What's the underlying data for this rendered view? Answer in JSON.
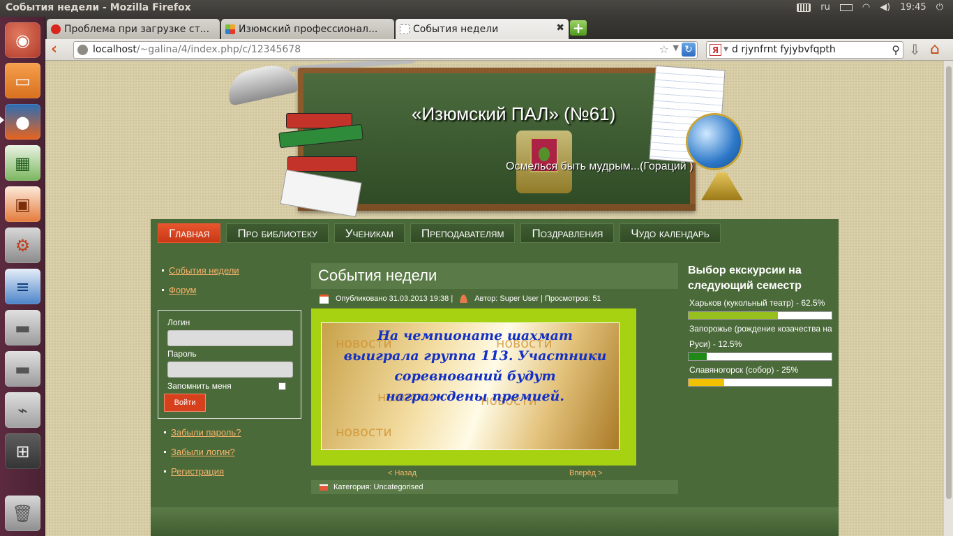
{
  "panel": {
    "window_title": "События недели - Mozilla Firefox",
    "keyboard_layout": "ru",
    "clock": "19:45",
    "icons": [
      "keyboard-icon",
      "battery-icon",
      "wifi-icon",
      "volume-icon"
    ]
  },
  "launcher": {
    "items": [
      "ubuntu-dash",
      "files",
      "firefox",
      "libreoffice-calc",
      "libreoffice-impress",
      "system-settings",
      "libreoffice-writer",
      "disk-1",
      "disk-2",
      "usb-drive",
      "workspace-switcher",
      "trash"
    ]
  },
  "tabs": [
    {
      "label": "Проблема при загрузке ст...",
      "icon": "warning-icon"
    },
    {
      "label": "Изюмский профессионал...",
      "icon": "joomla-icon"
    },
    {
      "label": "События недели",
      "icon": "blank-page-icon"
    }
  ],
  "navbar": {
    "url_host": "localhost",
    "url_path": "/~galina/4/index.php/c/12345678",
    "search_engine": "Я",
    "search_text": "d rjynfrnt fyjybvfqpth"
  },
  "site": {
    "title": "«Изюмский ПАЛ» (№61)",
    "slogan": "Осмелься быть мудрым...(Гораций )"
  },
  "menu": [
    {
      "label": "Главная",
      "active": true
    },
    {
      "label": "Про библиотеку",
      "active": false
    },
    {
      "label": "Ученикам",
      "active": false
    },
    {
      "label": "Преподавателям",
      "active": false
    },
    {
      "label": "Поздравления",
      "active": false
    },
    {
      "label": "Чудо календарь",
      "active": false
    }
  ],
  "sidebar": {
    "links": [
      "События недели",
      "Форум"
    ],
    "login": {
      "username_label": "Логин",
      "password_label": "Пароль",
      "remember_label": "Запомнить меня",
      "submit_label": "Войти"
    },
    "links2": [
      "Забыли пароль?",
      "Забыли логин?",
      "Регистрация"
    ]
  },
  "article": {
    "title": "События недели",
    "published": "Опубликовано 31.03.2013 19:38 |",
    "author": "Автор: Super User | Просмотров: 51",
    "image_text": "На чемпионате шахмат выиграла группа 113. Участники соревнований будут награждены премией.",
    "watermark": "новости",
    "prev": "< Назад",
    "next": "Вперёд >",
    "category": "Категория: Uncategorised"
  },
  "poll": {
    "title": "Выбор екскурсии на следующий семестр",
    "options": [
      {
        "label": "Харьков (кукольный театр) - 62.5%",
        "value": 62.5,
        "color": "#97c01e"
      },
      {
        "label": "Запорожье (рождение козачества на Руси) - 12.5%",
        "value": 12.5,
        "color": "#1f8a18"
      },
      {
        "label": "Славяногорск (собор) - 25%",
        "value": 25,
        "color": "#f2c200"
      }
    ]
  }
}
